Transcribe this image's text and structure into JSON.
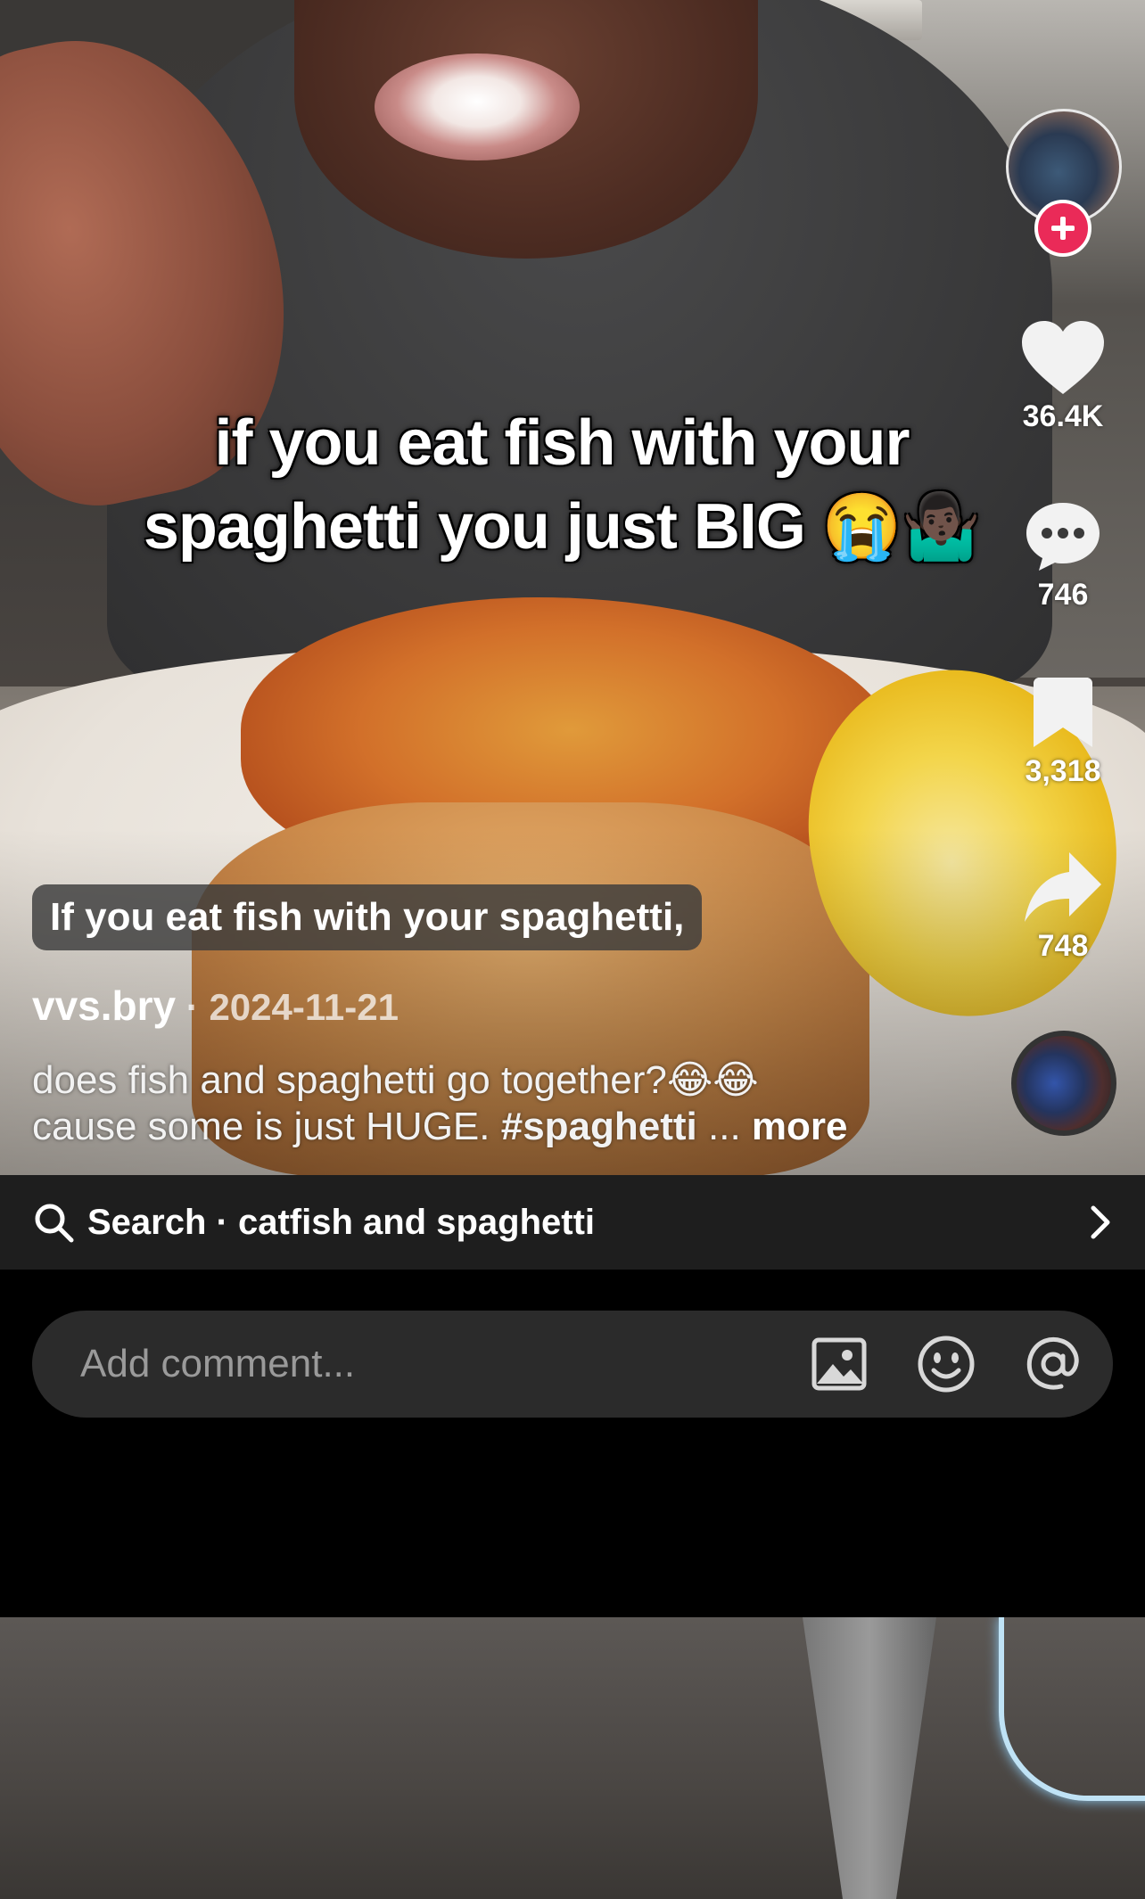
{
  "video": {
    "overlay_caption_line1": "if you eat fish with your",
    "overlay_caption_line2": "spaghetti you just BIG 😭🤷🏿‍♂️"
  },
  "rail": {
    "likes": "36.4K",
    "comments": "746",
    "saves": "3,318",
    "shares": "748",
    "follow_color": "#ea2a58"
  },
  "caption_chip": "If you eat fish with your spaghetti,",
  "author": {
    "username": "vvs.bry",
    "date": " · 2024-11-21"
  },
  "description": {
    "line1": "does fish and spaghetti go together?😂😂",
    "line2_text": "cause some is just HUGE. ",
    "hashtag": "#spaghetti",
    "ellipsis": " ... ",
    "more": "more"
  },
  "search": {
    "label": "Search · catfish and spaghetti"
  },
  "comment": {
    "placeholder": "Add comment..."
  },
  "icons": [
    "heart-icon",
    "comment-icon",
    "bookmark-icon",
    "share-icon",
    "search-icon",
    "chevron-right-icon",
    "image-icon",
    "emoji-icon",
    "mention-icon",
    "plus-icon"
  ]
}
